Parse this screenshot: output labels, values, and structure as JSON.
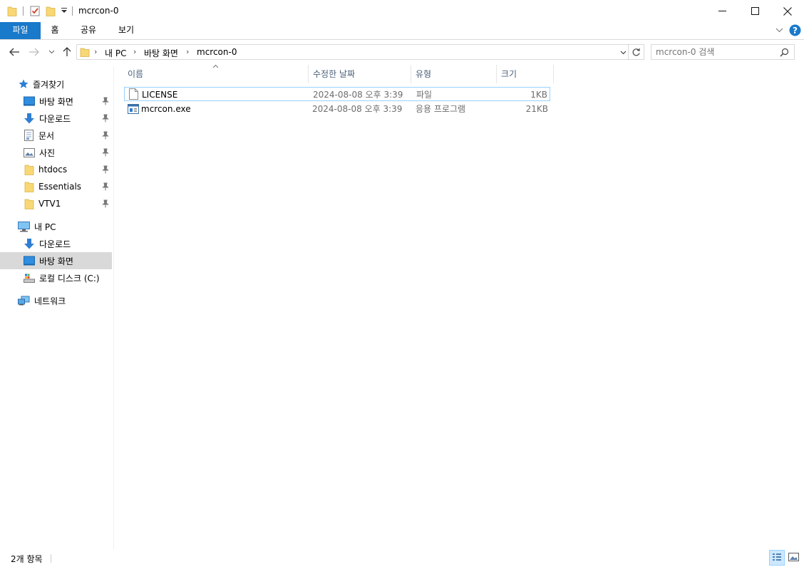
{
  "window": {
    "title": "mcrcon-0"
  },
  "ribbon": {
    "tabs": [
      {
        "label": "파일",
        "active": true
      },
      {
        "label": "홈"
      },
      {
        "label": "공유"
      },
      {
        "label": "보기"
      }
    ]
  },
  "address": {
    "crumbs": [
      "내 PC",
      "바탕 화면",
      "mcrcon-0"
    ]
  },
  "search": {
    "placeholder": "mcrcon-0 검색"
  },
  "nav": {
    "quick_access": "즐겨찾기",
    "quick_items": [
      "바탕 화면",
      "다운로드",
      "문서",
      "사진",
      "htdocs",
      "Essentials",
      "VTV1"
    ],
    "this_pc": "내 PC",
    "pc_items": [
      "다운로드",
      "바탕 화면",
      "로컬 디스크 (C:)"
    ],
    "network": "네트워크"
  },
  "columns": {
    "name": "이름",
    "modified": "수정한 날짜",
    "type": "유형",
    "size": "크기"
  },
  "files": [
    {
      "name": "LICENSE",
      "modified": "2024-08-08 오후 3:39",
      "type": "파일",
      "size": "1KB",
      "icon": "document-icon"
    },
    {
      "name": "mcrcon.exe",
      "modified": "2024-08-08 오후 3:39",
      "type": "응용 프로그램",
      "size": "21KB",
      "icon": "application-icon"
    }
  ],
  "status": {
    "count": "2개 항목"
  },
  "colors": {
    "accent": "#1979ca",
    "folder": "#f8d775",
    "selection_border": "#99d1ff",
    "nav_selected": "#d9d9d9"
  }
}
